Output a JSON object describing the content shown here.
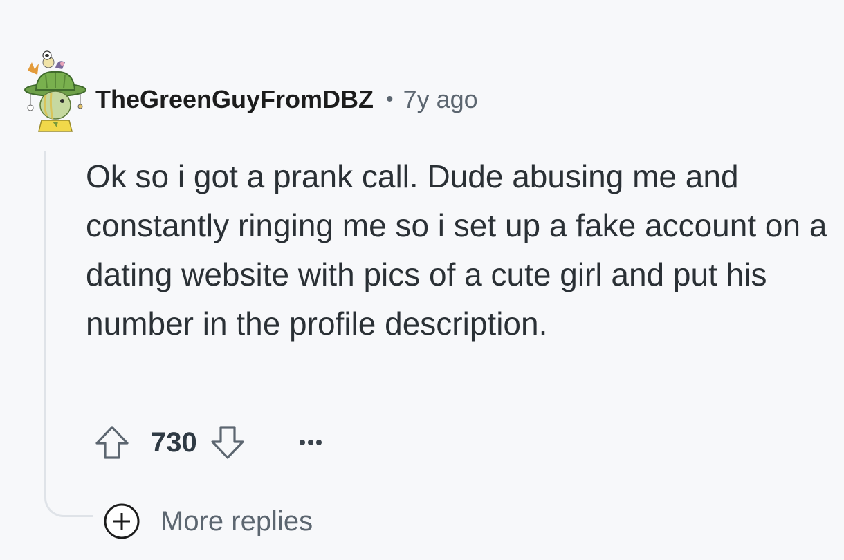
{
  "comment": {
    "author": "TheGreenGuyFromDBZ",
    "separator": "•",
    "timestamp": "7y ago",
    "body": "Ok so i got a prank call. Dude abusing me and constantly ringing me so i set up a fake account on a dating website with pics of a cute girl and put his number in the profile description.",
    "score": "730"
  },
  "icons": {
    "avatar": "snoo-avatar-icon",
    "upvote": "upvote-arrow-icon",
    "downvote": "downvote-arrow-icon",
    "more": "ellipsis-icon",
    "expand": "plus-circle-icon"
  },
  "replies": {
    "more_label": "More replies"
  },
  "colors": {
    "background": "#f7f8fa",
    "text_primary": "#1c1c1c",
    "text_secondary": "#5c6670",
    "thread_line": "#dfe3e8"
  }
}
